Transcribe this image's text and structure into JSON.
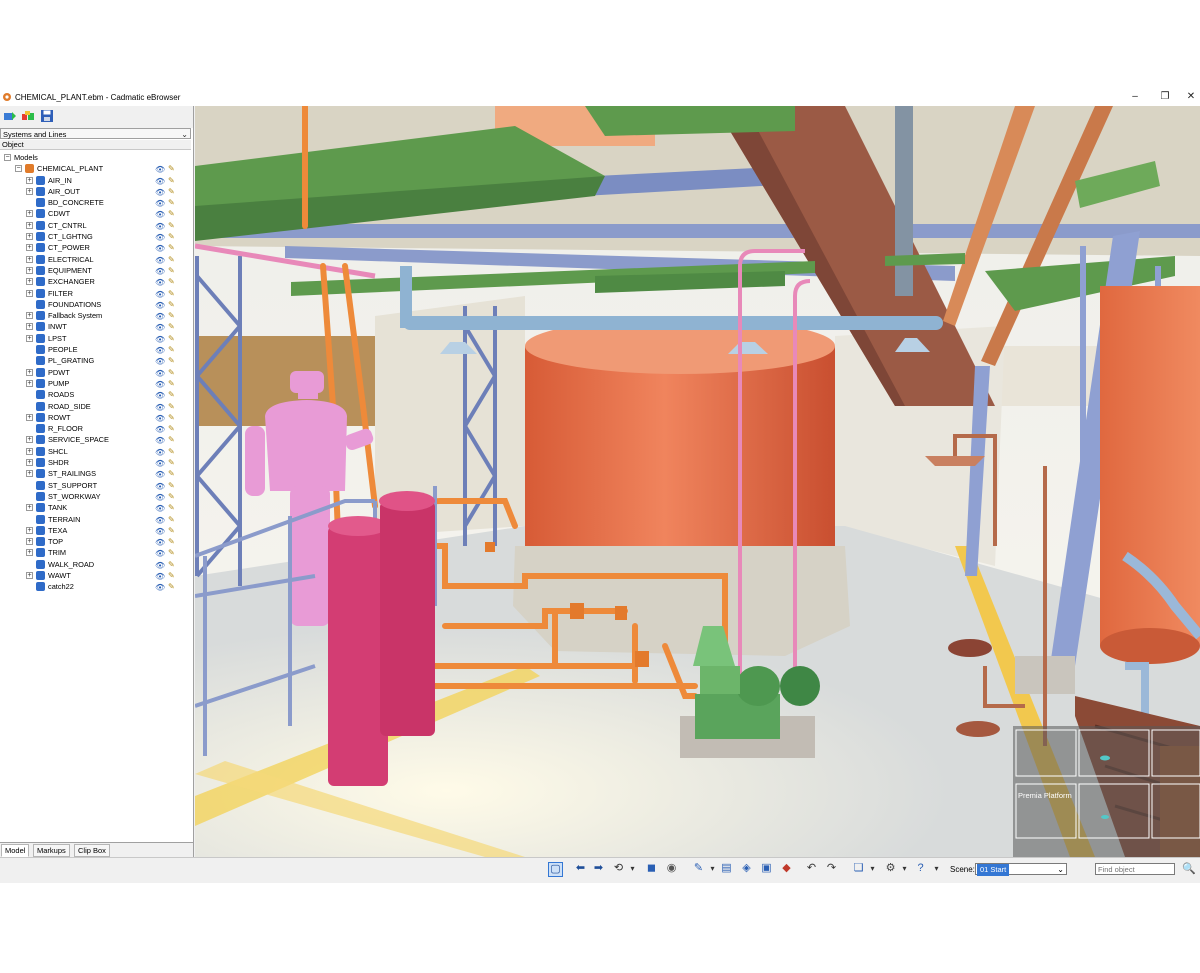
{
  "window": {
    "title": "CHEMICAL_PLANT.ebm - Cadmatic eBrowser",
    "controls": {
      "minimize": "–",
      "restore": "❐",
      "close": "✕"
    }
  },
  "left_panel": {
    "systems_dropdown": "Systems and Lines",
    "column_header": "Object",
    "tree": [
      {
        "label": "Models",
        "level": 0,
        "expander": "minus",
        "node_color": ""
      },
      {
        "label": "CHEMICAL_PLANT",
        "level": 1,
        "expander": "minus",
        "node_color": "#e07b2a"
      },
      {
        "label": "AIR_IN",
        "level": 2,
        "expander": "plus",
        "node_color": "#2f6bc8"
      },
      {
        "label": "AIR_OUT",
        "level": 2,
        "expander": "plus",
        "node_color": "#2f6bc8"
      },
      {
        "label": "BD_CONCRETE",
        "level": 2,
        "expander": "",
        "node_color": "#2f6bc8"
      },
      {
        "label": "CDWT",
        "level": 2,
        "expander": "plus",
        "node_color": "#2f6bc8"
      },
      {
        "label": "CT_CNTRL",
        "level": 2,
        "expander": "plus",
        "node_color": "#2f6bc8"
      },
      {
        "label": "CT_LGHTNG",
        "level": 2,
        "expander": "plus",
        "node_color": "#2f6bc8"
      },
      {
        "label": "CT_POWER",
        "level": 2,
        "expander": "plus",
        "node_color": "#2f6bc8"
      },
      {
        "label": "ELECTRICAL",
        "level": 2,
        "expander": "plus",
        "node_color": "#2f6bc8"
      },
      {
        "label": "EQUIPMENT",
        "level": 2,
        "expander": "plus",
        "node_color": "#2f6bc8"
      },
      {
        "label": "EXCHANGER",
        "level": 2,
        "expander": "plus",
        "node_color": "#2f6bc8"
      },
      {
        "label": "FILTER",
        "level": 2,
        "expander": "plus",
        "node_color": "#2f6bc8"
      },
      {
        "label": "FOUNDATIONS",
        "level": 2,
        "expander": "",
        "node_color": "#2f6bc8"
      },
      {
        "label": "Fallback System",
        "level": 2,
        "expander": "plus",
        "node_color": "#2f6bc8"
      },
      {
        "label": "INWT",
        "level": 2,
        "expander": "plus",
        "node_color": "#2f6bc8"
      },
      {
        "label": "LPST",
        "level": 2,
        "expander": "plus",
        "node_color": "#2f6bc8"
      },
      {
        "label": "PEOPLE",
        "level": 2,
        "expander": "",
        "node_color": "#2f6bc8"
      },
      {
        "label": "PL_GRATING",
        "level": 2,
        "expander": "",
        "node_color": "#2f6bc8"
      },
      {
        "label": "PDWT",
        "level": 2,
        "expander": "plus",
        "node_color": "#2f6bc8"
      },
      {
        "label": "PUMP",
        "level": 2,
        "expander": "plus",
        "node_color": "#2f6bc8"
      },
      {
        "label": "ROADS",
        "level": 2,
        "expander": "",
        "node_color": "#2f6bc8"
      },
      {
        "label": "ROAD_SIDE",
        "level": 2,
        "expander": "",
        "node_color": "#2f6bc8"
      },
      {
        "label": "ROWT",
        "level": 2,
        "expander": "plus",
        "node_color": "#2f6bc8"
      },
      {
        "label": "R_FLOOR",
        "level": 2,
        "expander": "",
        "node_color": "#2f6bc8"
      },
      {
        "label": "SERVICE_SPACE",
        "level": 2,
        "expander": "plus",
        "node_color": "#2f6bc8"
      },
      {
        "label": "SHCL",
        "level": 2,
        "expander": "plus",
        "node_color": "#2f6bc8"
      },
      {
        "label": "SHDR",
        "level": 2,
        "expander": "plus",
        "node_color": "#2f6bc8"
      },
      {
        "label": "ST_RAILINGS",
        "level": 2,
        "expander": "plus",
        "node_color": "#2f6bc8"
      },
      {
        "label": "ST_SUPPORT",
        "level": 2,
        "expander": "",
        "node_color": "#2f6bc8"
      },
      {
        "label": "ST_WORKWAY",
        "level": 2,
        "expander": "",
        "node_color": "#2f6bc8"
      },
      {
        "label": "TANK",
        "level": 2,
        "expander": "plus",
        "node_color": "#2f6bc8"
      },
      {
        "label": "TERRAIN",
        "level": 2,
        "expander": "",
        "node_color": "#2f6bc8"
      },
      {
        "label": "TEXA",
        "level": 2,
        "expander": "plus",
        "node_color": "#2f6bc8"
      },
      {
        "label": "TOP",
        "level": 2,
        "expander": "plus",
        "node_color": "#2f6bc8"
      },
      {
        "label": "TRIM",
        "level": 2,
        "expander": "plus",
        "node_color": "#2f6bc8"
      },
      {
        "label": "WALK_ROAD",
        "level": 2,
        "expander": "",
        "node_color": "#2f6bc8"
      },
      {
        "label": "WAWT",
        "level": 2,
        "expander": "plus",
        "node_color": "#2f6bc8"
      },
      {
        "label": "catch22",
        "level": 2,
        "expander": "",
        "node_color": "#2f6bc8"
      }
    ],
    "tabs": [
      "Model",
      "Markups",
      "Clip Box"
    ]
  },
  "viewport": {
    "minimap_label": "Premia Platform"
  },
  "bottom_toolbar": {
    "scene_label": "Scene:",
    "scene_value": "01 Start",
    "find_placeholder": "Find object"
  },
  "colors": {
    "tank_orange": "#e8714a",
    "steel_blue": "#8a9ed2",
    "beam_green": "#5e9a4d",
    "pipe_orange": "#ee8a3a",
    "person_pink": "#e89bd6",
    "floor": "#d9dcdc"
  }
}
